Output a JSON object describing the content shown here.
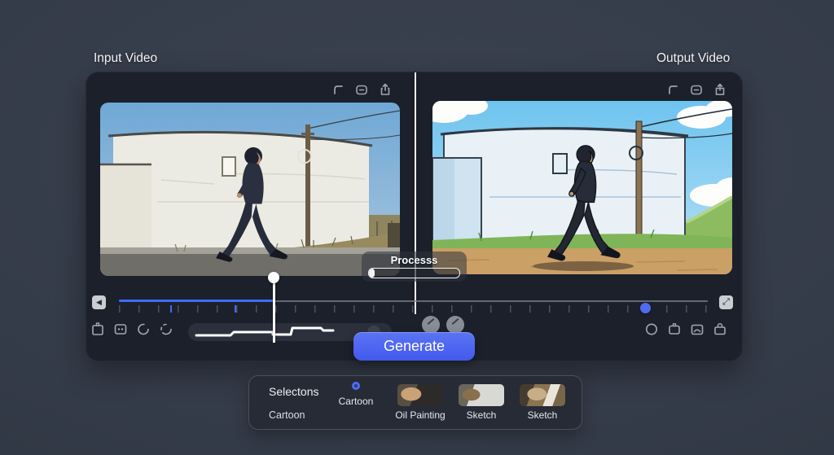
{
  "header": {
    "input_label": "Input Video",
    "output_label": "Output Video"
  },
  "process": {
    "label": "Processs",
    "progress_percent": 6
  },
  "timeline": {
    "playhead_percent": 26,
    "marker_percent": 89
  },
  "generate": {
    "label": "Generate"
  },
  "selections": {
    "title": "Selectons",
    "category_label": "Cartoon",
    "options": [
      {
        "label": "Cartoon",
        "selected": true
      },
      {
        "label": "Oil Painting",
        "selected": false
      },
      {
        "label": "Sketch",
        "selected": false
      },
      {
        "label": "Sketch",
        "selected": false
      }
    ]
  },
  "icons": {
    "skip_start": "◀",
    "expand": "⤢"
  },
  "colors": {
    "accent": "#4f6bf2",
    "timeline_blue": "#3d6ef7",
    "background": "#353b48",
    "panel": "#1c202b",
    "divider": "#ffffff"
  }
}
